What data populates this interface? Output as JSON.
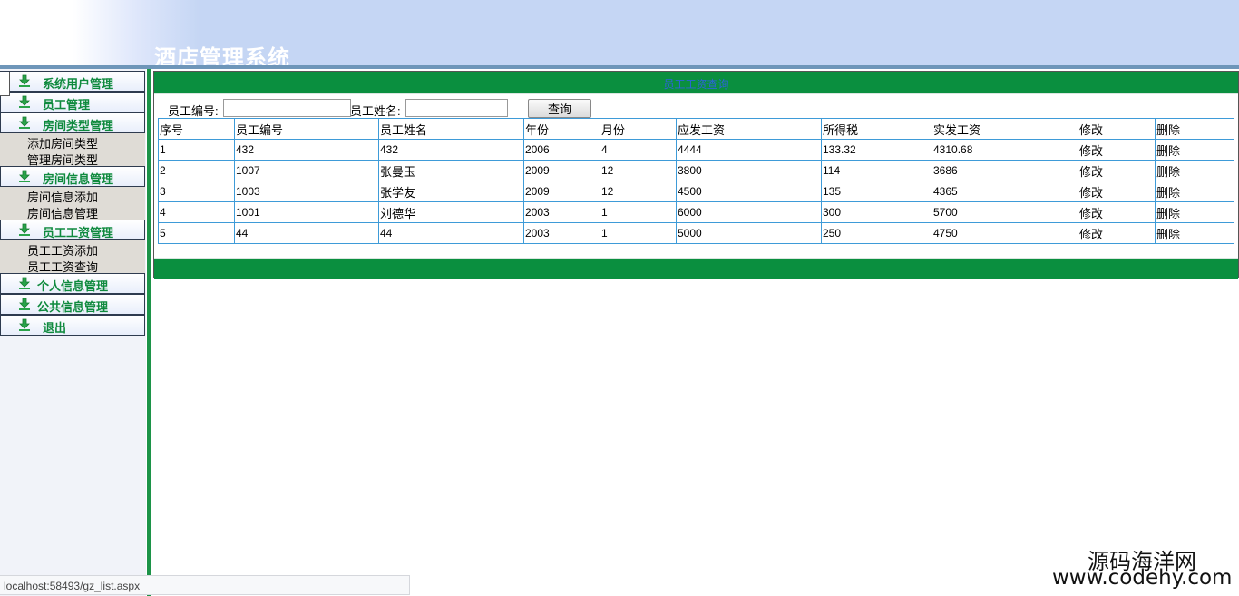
{
  "header": {
    "app_title": "酒店管理系统"
  },
  "sidebar": {
    "groups": [
      {
        "label": "系统用户管理",
        "items": []
      },
      {
        "label": "员工管理",
        "items": []
      },
      {
        "label": "房间类型管理",
        "items": [
          "添加房间类型",
          "管理房间类型"
        ]
      },
      {
        "label": "房间信息管理",
        "items": [
          "房间信息添加",
          "房间信息管理"
        ]
      },
      {
        "label": "员工工资管理",
        "items": [
          "员工工资添加",
          "员工工资查询"
        ]
      },
      {
        "label": "个人信息管理",
        "items": []
      },
      {
        "label": "公共信息管理",
        "items": []
      },
      {
        "label": "退出",
        "items": []
      }
    ]
  },
  "main": {
    "panel_title": "员工工资查询",
    "search": {
      "employee_no_label": "员工编号:",
      "employee_no_value": "",
      "employee_name_label": "员工姓名:",
      "employee_name_value": "",
      "query_button": "查询"
    },
    "table": {
      "columns": [
        "序号",
        "员工编号",
        "员工姓名",
        "年份",
        "月份",
        "应发工资",
        "所得税",
        "实发工资",
        "修改",
        "删除"
      ],
      "rows": [
        [
          "1",
          "432",
          "432",
          "2006",
          "4",
          "4444",
          "133.32",
          "4310.68",
          "修改",
          "删除"
        ],
        [
          "2",
          "1007",
          "张曼玉",
          "2009",
          "12",
          "3800",
          "114",
          "3686",
          "修改",
          "删除"
        ],
        [
          "3",
          "1003",
          "张学友",
          "2009",
          "12",
          "4500",
          "135",
          "4365",
          "修改",
          "删除"
        ],
        [
          "4",
          "1001",
          "刘德华",
          "2003",
          "1",
          "6000",
          "300",
          "5700",
          "修改",
          "删除"
        ],
        [
          "5",
          "44",
          "44",
          "2003",
          "1",
          "5000",
          "250",
          "4750",
          "修改",
          "删除"
        ]
      ]
    }
  },
  "status_bar": {
    "url": "localhost:58493/gz_list.aspx"
  },
  "watermark": {
    "name": "源码海洋网",
    "url": "www.codehy.com"
  },
  "colors": {
    "green_bar": "#0a8f3f",
    "nav_text": "#0f8a3e",
    "table_border": "#3e9bd8",
    "header_bg": "#c5d6f4"
  }
}
